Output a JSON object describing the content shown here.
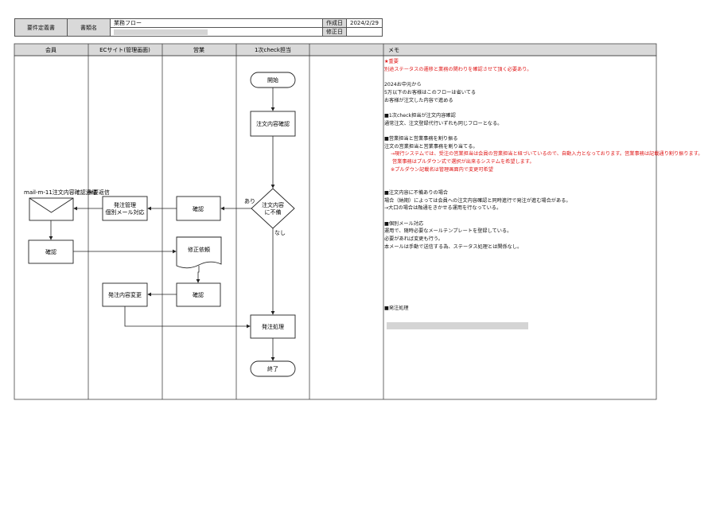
{
  "header": {
    "doc_label": "要件定義書",
    "docname_label": "書類名",
    "docname_value": "業務フロー",
    "created_label": "作成日",
    "created_value": "2024/2/29",
    "modified_label": "修正日",
    "modified_value": ""
  },
  "lanes": [
    "会員",
    "ECサイト(管理画面)",
    "営業",
    "1次check担当",
    "",
    "メモ"
  ],
  "flow": {
    "start": "開始",
    "order_check": "注文内容確認",
    "decision_line1": "注文内容",
    "decision_line2": "に不備",
    "yes_label": "あり",
    "no_label": "なし",
    "sales_confirm1": "確認",
    "order_mgmt_line1": "発注管理",
    "order_mgmt_line2": "個別メール対応",
    "mail_caption": "mail-m-11注文内容確認連絡",
    "resend_note": "※要返信",
    "member_confirm": "確認",
    "fix_request": "修正依頼",
    "sales_confirm2": "確認",
    "order_change": "発注内容変更",
    "order_process": "発注処理",
    "end": "終了"
  },
  "memo": [
    {
      "text": "★重要",
      "cls": "red"
    },
    {
      "text": "別途ステータスの遷移と業務の関わりを確認させて頂く必要あり。",
      "cls": "red"
    },
    {
      "text": "",
      "cls": ""
    },
    {
      "text": "2024お中元から",
      "cls": ""
    },
    {
      "text": "5万以下のお客様はこのフローは省いてる",
      "cls": ""
    },
    {
      "text": "お客様が注文した内容で進める",
      "cls": ""
    },
    {
      "text": "",
      "cls": ""
    },
    {
      "text": "■1次check担当が注文内容確認",
      "cls": ""
    },
    {
      "text": "通常注文、注文登録代行いずれも同じフローとなる。",
      "cls": ""
    },
    {
      "text": "",
      "cls": ""
    },
    {
      "text": "■営業担当と営業事務を割り振る",
      "cls": ""
    },
    {
      "text": "注文の営業担当と営業事務を割り当てる。",
      "cls": ""
    },
    {
      "text": "→現行システムでは、受注の営業担当は会員の営業担当と紐づいているので、自動入力となっております。営業事務は記載通り割り振ります。",
      "cls": "red ind1"
    },
    {
      "text": "営業事務はプルダウン式で選択が出来るシステムを希望します。",
      "cls": "red ind2"
    },
    {
      "text": "※プルダウン記載名は管理画面内で変更可希望",
      "cls": "red ind1"
    },
    {
      "text": "",
      "cls": ""
    },
    {
      "text": "",
      "cls": ""
    },
    {
      "text": "■注文内容に不備ありの場合",
      "cls": ""
    },
    {
      "text": "場合（納期）によっては会員への注文内容確認と同時進行で発注が進む場合がある。",
      "cls": ""
    },
    {
      "text": "→大口の場合は融通をきかせる運用を行なっている。",
      "cls": ""
    },
    {
      "text": "",
      "cls": ""
    },
    {
      "text": "■個別メール対応",
      "cls": ""
    },
    {
      "text": "運用で、随時必要なメールテンプレートを登録している。",
      "cls": ""
    },
    {
      "text": "必要があれば変更も行う。",
      "cls": ""
    },
    {
      "text": "本メールは手動で送信する為、ステータス処理とは関係なし。",
      "cls": ""
    },
    {
      "text": "",
      "cls": ""
    },
    {
      "text": "",
      "cls": ""
    },
    {
      "text": "",
      "cls": ""
    },
    {
      "text": "",
      "cls": ""
    },
    {
      "text": "",
      "cls": ""
    },
    {
      "text": "",
      "cls": ""
    },
    {
      "text": "",
      "cls": ""
    },
    {
      "text": "■発注処理",
      "cls": ""
    }
  ],
  "colors": {
    "header_fill": "#d9d9d9",
    "redaction": "#d4d4d4",
    "memo_red": "#e01818"
  }
}
